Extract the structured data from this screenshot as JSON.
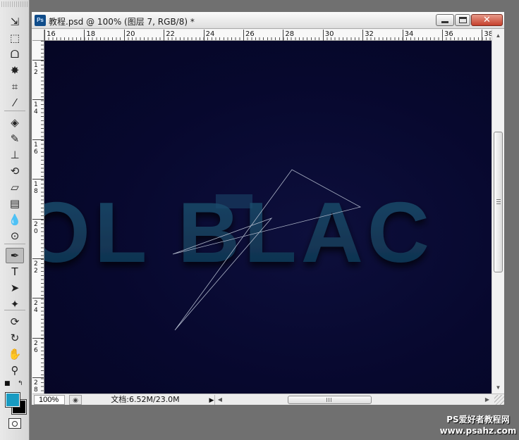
{
  "tools": {
    "items": [
      {
        "name": "move-tool-icon",
        "glyph": "⇲"
      },
      {
        "name": "rectangular-marquee-tool-icon",
        "glyph": "⬚"
      },
      {
        "name": "lasso-tool-icon",
        "glyph": "ᗝ"
      },
      {
        "name": "magic-wand-tool-icon",
        "glyph": "✸"
      },
      {
        "name": "crop-tool-icon",
        "glyph": "⌗"
      },
      {
        "name": "eyedropper-tool-icon",
        "glyph": "⁄"
      },
      {
        "name": "spot-healing-brush-tool-icon",
        "glyph": "◈"
      },
      {
        "name": "brush-tool-icon",
        "glyph": "✎"
      },
      {
        "name": "clone-stamp-tool-icon",
        "glyph": "⊥"
      },
      {
        "name": "history-brush-tool-icon",
        "glyph": "⟲"
      },
      {
        "name": "eraser-tool-icon",
        "glyph": "▱"
      },
      {
        "name": "gradient-tool-icon",
        "glyph": "▤"
      },
      {
        "name": "blur-tool-icon",
        "glyph": "💧"
      },
      {
        "name": "dodge-tool-icon",
        "glyph": "⊙"
      },
      {
        "name": "pen-tool-icon",
        "glyph": "✒"
      },
      {
        "name": "type-tool-icon",
        "glyph": "T"
      },
      {
        "name": "path-selection-tool-icon",
        "glyph": "➤"
      },
      {
        "name": "custom-shape-tool-icon",
        "glyph": "✦"
      },
      {
        "name": "3d-rotate-tool-icon",
        "glyph": "⟳"
      },
      {
        "name": "3d-orbit-tool-icon",
        "glyph": "↻"
      },
      {
        "name": "hand-tool-icon",
        "glyph": "✋"
      },
      {
        "name": "zoom-tool-icon",
        "glyph": "⚲"
      }
    ],
    "active": "pen-tool-icon",
    "foreground_color": "#189bc2",
    "background_color": "#000000"
  },
  "document": {
    "app_icon_label": "Ps",
    "title": "教程.psd @ 100% (图层 7, RGB/8) *",
    "zoom": "100%",
    "doc_info": "文档:6.52M/23.0M",
    "canvas_text": "OL BLAC",
    "canvas_bg": "#07082e",
    "text_color": "#123a5a"
  },
  "rulers": {
    "horizontal": [
      "16",
      "18",
      "20",
      "22",
      "24",
      "26",
      "28",
      "30",
      "32",
      "34",
      "36",
      "38"
    ],
    "vertical": [
      "12",
      "14",
      "16",
      "18",
      "20",
      "22",
      "24",
      "26",
      "28"
    ]
  },
  "watermark": {
    "line1": "PS爱好者教程网",
    "line2": "www.psahz.com"
  }
}
